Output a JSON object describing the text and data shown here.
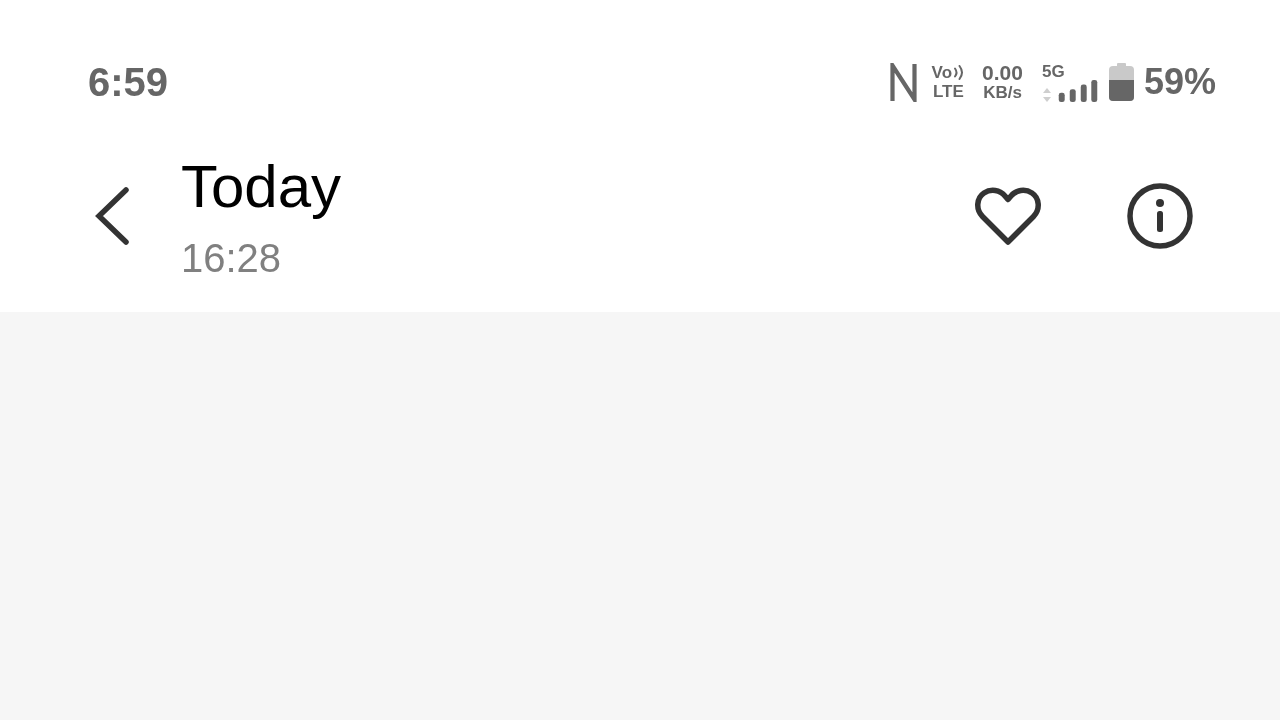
{
  "status_bar": {
    "time": "6:59",
    "volte": {
      "top": "Vo",
      "bottom": "LTE"
    },
    "network_speed": {
      "value": "0.00",
      "unit": "KB/s"
    },
    "network_type": "5G",
    "battery_percent": "59%"
  },
  "header": {
    "title": "Today",
    "subtitle": "16:28"
  }
}
